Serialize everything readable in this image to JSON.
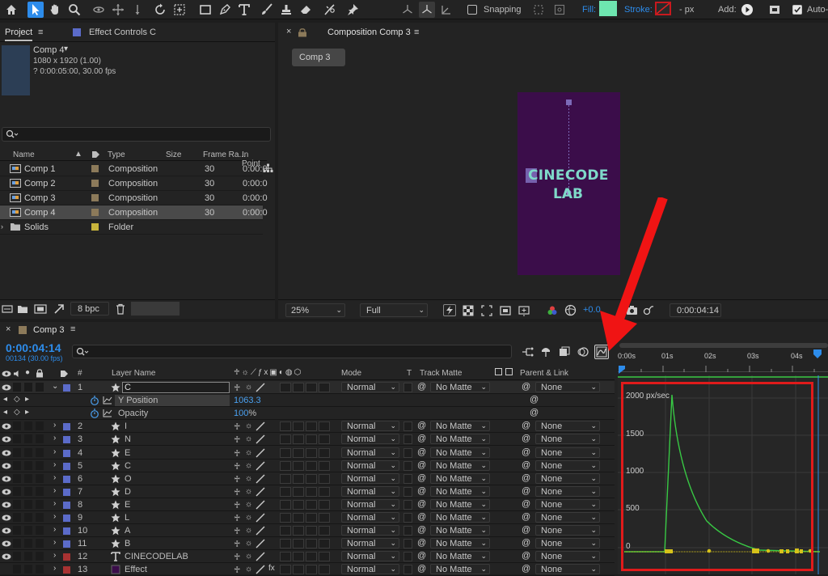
{
  "toolbar": {
    "tools": [
      "home-icon",
      "selection-arrow-icon",
      "hand-icon",
      "zoom-icon",
      "orbit-camera-icon",
      "pan-camera-icon",
      "dolly-camera-icon",
      "rotate-icon",
      "pan-behind-icon",
      "rectangle-icon",
      "pen-icon",
      "type-icon",
      "brush-icon",
      "clone-stamp-icon",
      "eraser-icon",
      "roto-brush-icon",
      "puppet-pin-icon"
    ],
    "snapping_label": "Snapping",
    "fill_label": "Fill:",
    "stroke_label": "Stroke:",
    "stroke_value": "- px",
    "add_label": "Add:",
    "auto_label": "Auto-"
  },
  "project": {
    "tab_label": "Project",
    "effect_tab_label": "Effect Controls C",
    "comp_name": "Comp 4",
    "comp_dims": "1080 x 1920 (1.00)",
    "comp_duration": "? 0:00:05:00, 30.00 fps",
    "search_placeholder": "",
    "columns": {
      "name": "Name",
      "type": "Type",
      "size": "Size",
      "frame_rate": "Frame Ra...",
      "in_point": "In Point"
    },
    "items": [
      {
        "name": "Comp 1",
        "type": "Composition",
        "frame_rate": "30",
        "in_point": "0:00:0",
        "color": "#8c7a5a",
        "selected": false
      },
      {
        "name": "Comp 2",
        "type": "Composition",
        "frame_rate": "30",
        "in_point": "0:00:0",
        "color": "#8c7a5a",
        "selected": false
      },
      {
        "name": "Comp 3",
        "type": "Composition",
        "frame_rate": "30",
        "in_point": "0:00:0",
        "color": "#8c7a5a",
        "selected": false
      },
      {
        "name": "Comp 4",
        "type": "Composition",
        "frame_rate": "30",
        "in_point": "0:00:0",
        "color": "#8c7a5a",
        "selected": true
      },
      {
        "name": "Solids",
        "type": "Folder",
        "frame_rate": "",
        "in_point": "",
        "color": "#c8b43c",
        "selected": false
      }
    ],
    "bpc_label": "8 bpc"
  },
  "viewer": {
    "tab_label": "Composition Comp 3",
    "comp_chip": "Comp 3",
    "title_line1": "CINECODE",
    "title_line2": "LAB",
    "zoom_value": "25%",
    "quality_value": "Full",
    "exposure_value": "+0.0",
    "timecode": "0:00:04:14",
    "bg_color": "#3b0d4a",
    "text_color": "#7fd9c9"
  },
  "timeline": {
    "tab_label": "Comp 3",
    "timecode": "0:00:04:14",
    "frame_info": "00134 (30.00 fps)",
    "search_placeholder": "",
    "columns": {
      "num": "#",
      "layer_name": "Layer Name",
      "mode": "Mode",
      "t": "T",
      "track_matte": "Track Matte",
      "parent": "Parent & Link"
    },
    "layers": [
      {
        "num": "1",
        "name": "C",
        "mode": "Normal",
        "matte": "No Matte",
        "parent": "None",
        "color": "#5b6bc9",
        "type": "star",
        "expanded": true
      },
      {
        "num": "2",
        "name": "I",
        "mode": "Normal",
        "matte": "No Matte",
        "parent": "None",
        "color": "#5b6bc9",
        "type": "star"
      },
      {
        "num": "3",
        "name": "N",
        "mode": "Normal",
        "matte": "No Matte",
        "parent": "None",
        "color": "#5b6bc9",
        "type": "star"
      },
      {
        "num": "4",
        "name": "E",
        "mode": "Normal",
        "matte": "No Matte",
        "parent": "None",
        "color": "#5b6bc9",
        "type": "star"
      },
      {
        "num": "5",
        "name": "C",
        "mode": "Normal",
        "matte": "No Matte",
        "parent": "None",
        "color": "#5b6bc9",
        "type": "star"
      },
      {
        "num": "6",
        "name": "O",
        "mode": "Normal",
        "matte": "No Matte",
        "parent": "None",
        "color": "#5b6bc9",
        "type": "star"
      },
      {
        "num": "7",
        "name": "D",
        "mode": "Normal",
        "matte": "No Matte",
        "parent": "None",
        "color": "#5b6bc9",
        "type": "star"
      },
      {
        "num": "8",
        "name": "E",
        "mode": "Normal",
        "matte": "No Matte",
        "parent": "None",
        "color": "#5b6bc9",
        "type": "star"
      },
      {
        "num": "9",
        "name": "L",
        "mode": "Normal",
        "matte": "No Matte",
        "parent": "None",
        "color": "#5b6bc9",
        "type": "star"
      },
      {
        "num": "10",
        "name": "A",
        "mode": "Normal",
        "matte": "No Matte",
        "parent": "None",
        "color": "#5b6bc9",
        "type": "star"
      },
      {
        "num": "11",
        "name": "B",
        "mode": "Normal",
        "matte": "No Matte",
        "parent": "None",
        "color": "#5b6bc9",
        "type": "star"
      },
      {
        "num": "12",
        "name": "CINECODELAB",
        "mode": "Normal",
        "matte": "No Matte",
        "parent": "None",
        "color": "#a83232",
        "type": "text"
      },
      {
        "num": "13",
        "name": "Effect",
        "mode": "Normal",
        "matte": "No Matte",
        "parent": "None",
        "color": "#a83232",
        "type": "solid"
      }
    ],
    "properties": [
      {
        "name": "Y Position",
        "value": "1063.3"
      },
      {
        "name": "Opacity",
        "value": "100",
        "unit": "%"
      }
    ],
    "ruler": [
      "0:00s",
      "01s",
      "02s",
      "03s",
      "04s"
    ]
  },
  "graph": {
    "y_ticks": [
      "2000 px/sec",
      "1500",
      "1000",
      "500",
      "0"
    ],
    "highlight_color": "#e01b1b",
    "curve_color": "#38c844",
    "keyframe_color": "#d6c21a"
  },
  "annotation": {
    "arrow_color": "#f01414"
  }
}
